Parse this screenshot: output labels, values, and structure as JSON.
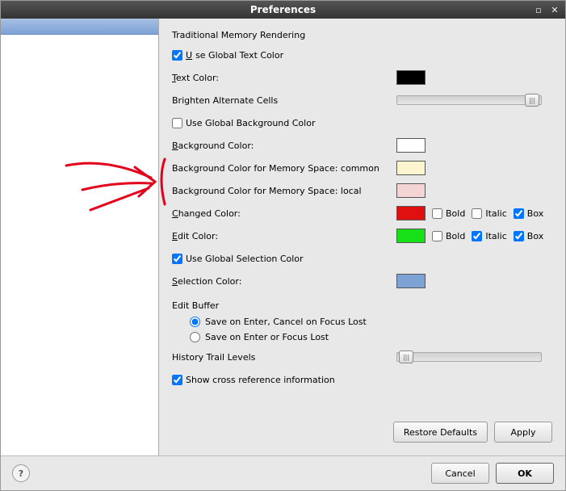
{
  "window": {
    "title": "Preferences"
  },
  "section": "Traditional Memory Rendering",
  "useGlobalTextColor": {
    "label": "Use Global Text Color",
    "value": true
  },
  "textColor": {
    "label": "Text Color:",
    "value": "#000000"
  },
  "brightenAlternate": {
    "label": "Brighten Alternate Cells",
    "sliderPos": 0.88
  },
  "useGlobalBg": {
    "label": "Use Global Background Color",
    "value": false
  },
  "backgroundColor": {
    "label": "Background Color:",
    "value": "#ffffff"
  },
  "bgSpaceCommon": {
    "label": "Background Color for Memory Space: common",
    "value": "#fcf5d0"
  },
  "bgSpaceLocal": {
    "label": "Background Color for Memory Space: local",
    "value": "#f4d4d4"
  },
  "changedColor": {
    "label": "Changed Color:",
    "value": "#e01010",
    "bold": false,
    "italic": false,
    "box": true
  },
  "editColor": {
    "label": "Edit Color:",
    "value": "#18e018",
    "bold": false,
    "italic": true,
    "box": true
  },
  "styleLabels": {
    "bold": "Bold",
    "italic": "Italic",
    "box": "Box"
  },
  "useGlobalSelection": {
    "label": "Use Global Selection Color",
    "value": true
  },
  "selectionColor": {
    "label": "Selection Color:",
    "value": "#7da2d6"
  },
  "editBuffer": {
    "label": "Edit Buffer",
    "opt1": "Save on Enter, Cancel on Focus Lost",
    "opt2": "Save on Enter or Focus Lost",
    "selected": 1
  },
  "historyTrail": {
    "label": "History Trail Levels",
    "sliderPos": 0.03
  },
  "showCrossRef": {
    "label": "Show cross reference information",
    "value": true
  },
  "buttons": {
    "restoreDefaults": "Restore Defaults",
    "apply": "Apply",
    "cancel": "Cancel",
    "ok": "OK"
  }
}
